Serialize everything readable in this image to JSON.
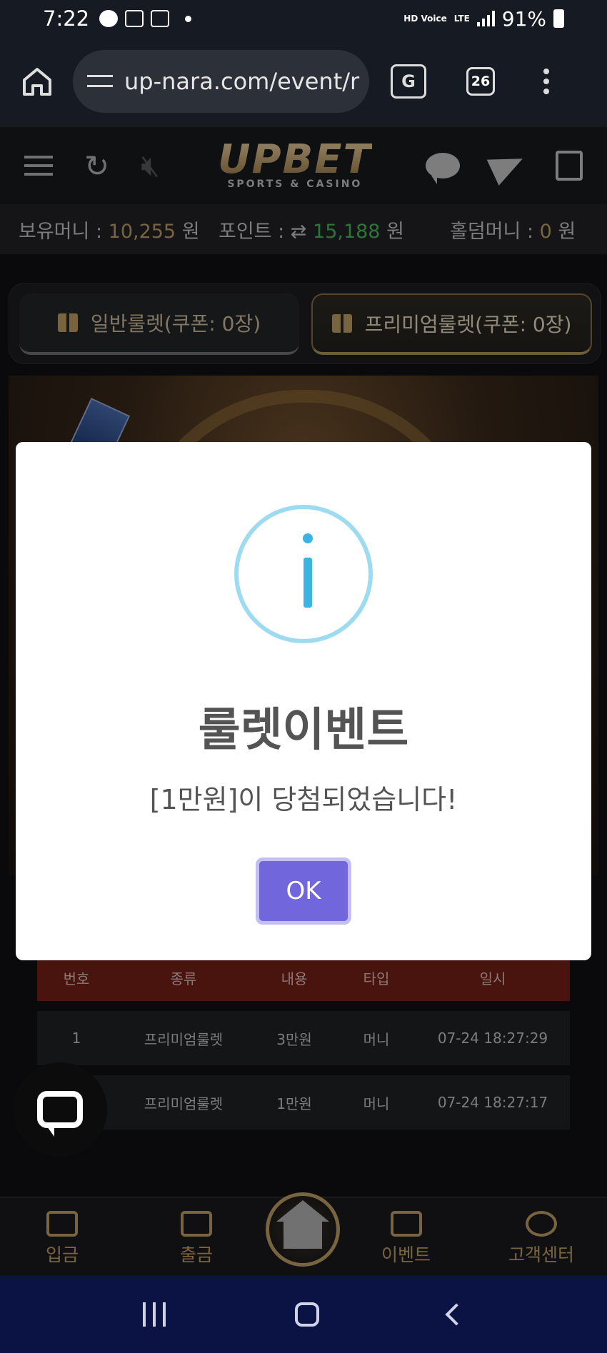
{
  "status_bar": {
    "time": "7:22",
    "network_hd": "HD Voice",
    "network_lte": "LTE",
    "battery": "91%"
  },
  "browser": {
    "url": "up-nara.com/event/r",
    "tabs_count": "26"
  },
  "site": {
    "logo": "UPBET",
    "logo_sub": "SPORTS & CASINO",
    "money": {
      "label": "보유머니 :",
      "value": "10,255",
      "unit": "원"
    },
    "points": {
      "label": "포인트 :",
      "value": "15,188",
      "unit": "원"
    },
    "holdem": {
      "label": "홀덤머니 :",
      "value": "0",
      "unit": "원"
    }
  },
  "coupons": {
    "normal": "일반룰렛(쿠폰: 0장)",
    "premium": "프리미엄룰렛(쿠폰: 0장)"
  },
  "history": {
    "headers": [
      "번호",
      "종류",
      "내용",
      "타입",
      "일시"
    ],
    "rows": [
      {
        "no": "1",
        "kind": "프리미엄룰렛",
        "content": "3만원",
        "type": "머니",
        "date": "07-24 18:27:29"
      },
      {
        "no": "",
        "kind": "프리미엄룰렛",
        "content": "1만원",
        "type": "머니",
        "date": "07-24 18:27:17"
      }
    ]
  },
  "bottom_nav": {
    "deposit": "입금",
    "withdraw": "출금",
    "event": "이벤트",
    "support": "고객센터"
  },
  "modal": {
    "title": "룰렛이벤트",
    "message": "[1만원]이 당첨되었습니다!",
    "ok_label": "OK"
  },
  "colors": {
    "accent_gold": "#c9a86b",
    "points_green": "#4cc15f",
    "ok_purple": "#7266dc",
    "info_blue": "#3cb3e5"
  }
}
